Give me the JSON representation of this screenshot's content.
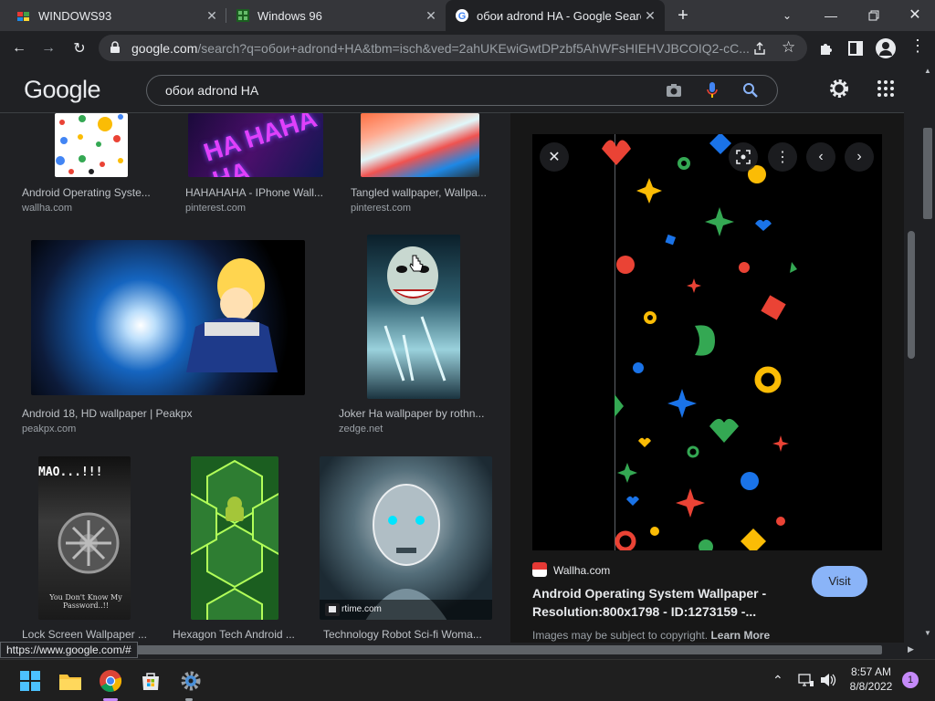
{
  "tabs": [
    {
      "title": "WINDOWS93",
      "active": false
    },
    {
      "title": "Windows 96",
      "active": false
    },
    {
      "title": "обои adrond HA - Google Search",
      "active": true
    }
  ],
  "address": {
    "host": "google.com",
    "path": "/search?q=обои+adrond+HA&tbm=isch&ved=2ahUKEwiGwtDPzbf5AhWFsHIEHVJBCOIQ2-cC..."
  },
  "google": {
    "logo": "Google",
    "query": "обои adrond HA"
  },
  "results": [
    {
      "caption": "Android Operating Syste...",
      "source": "wallha.com"
    },
    {
      "caption": "HAHAHAHA - IPhone Wall...",
      "source": "pinterest.com"
    },
    {
      "caption": "Tangled wallpaper, Wallpa...",
      "source": "pinterest.com"
    },
    {
      "caption": "Android 18, HD wallpaper | Peakpx",
      "source": "peakpx.com"
    },
    {
      "caption": "Joker Ha wallpaper by rothn...",
      "source": "zedge.net"
    },
    {
      "caption": "Lock Screen Wallpaper ...",
      "source": ""
    },
    {
      "caption": "Hexagon Tech Android ...",
      "source": ""
    },
    {
      "caption": "Technology Robot Sci-fi Woma...",
      "source": ""
    }
  ],
  "thumb_texts": {
    "hahaha": "HA HAHA HA",
    "lock_top": "MAO...!!!",
    "lock_bottom": "You Don't Know My Password..!!",
    "robot_tag": "rtime.com"
  },
  "panel": {
    "site": "Wallha.com",
    "title": "Android Operating System Wallpaper - Resolution:800x1798 - ID:1273159 -...",
    "visit": "Visit",
    "note_prefix": "Images may be subject to copyright. ",
    "learn_more": "Learn More"
  },
  "status_url": "https://www.google.com/#",
  "taskbar": {
    "time": "8:57 AM",
    "date": "8/8/2022",
    "badge": "1"
  }
}
